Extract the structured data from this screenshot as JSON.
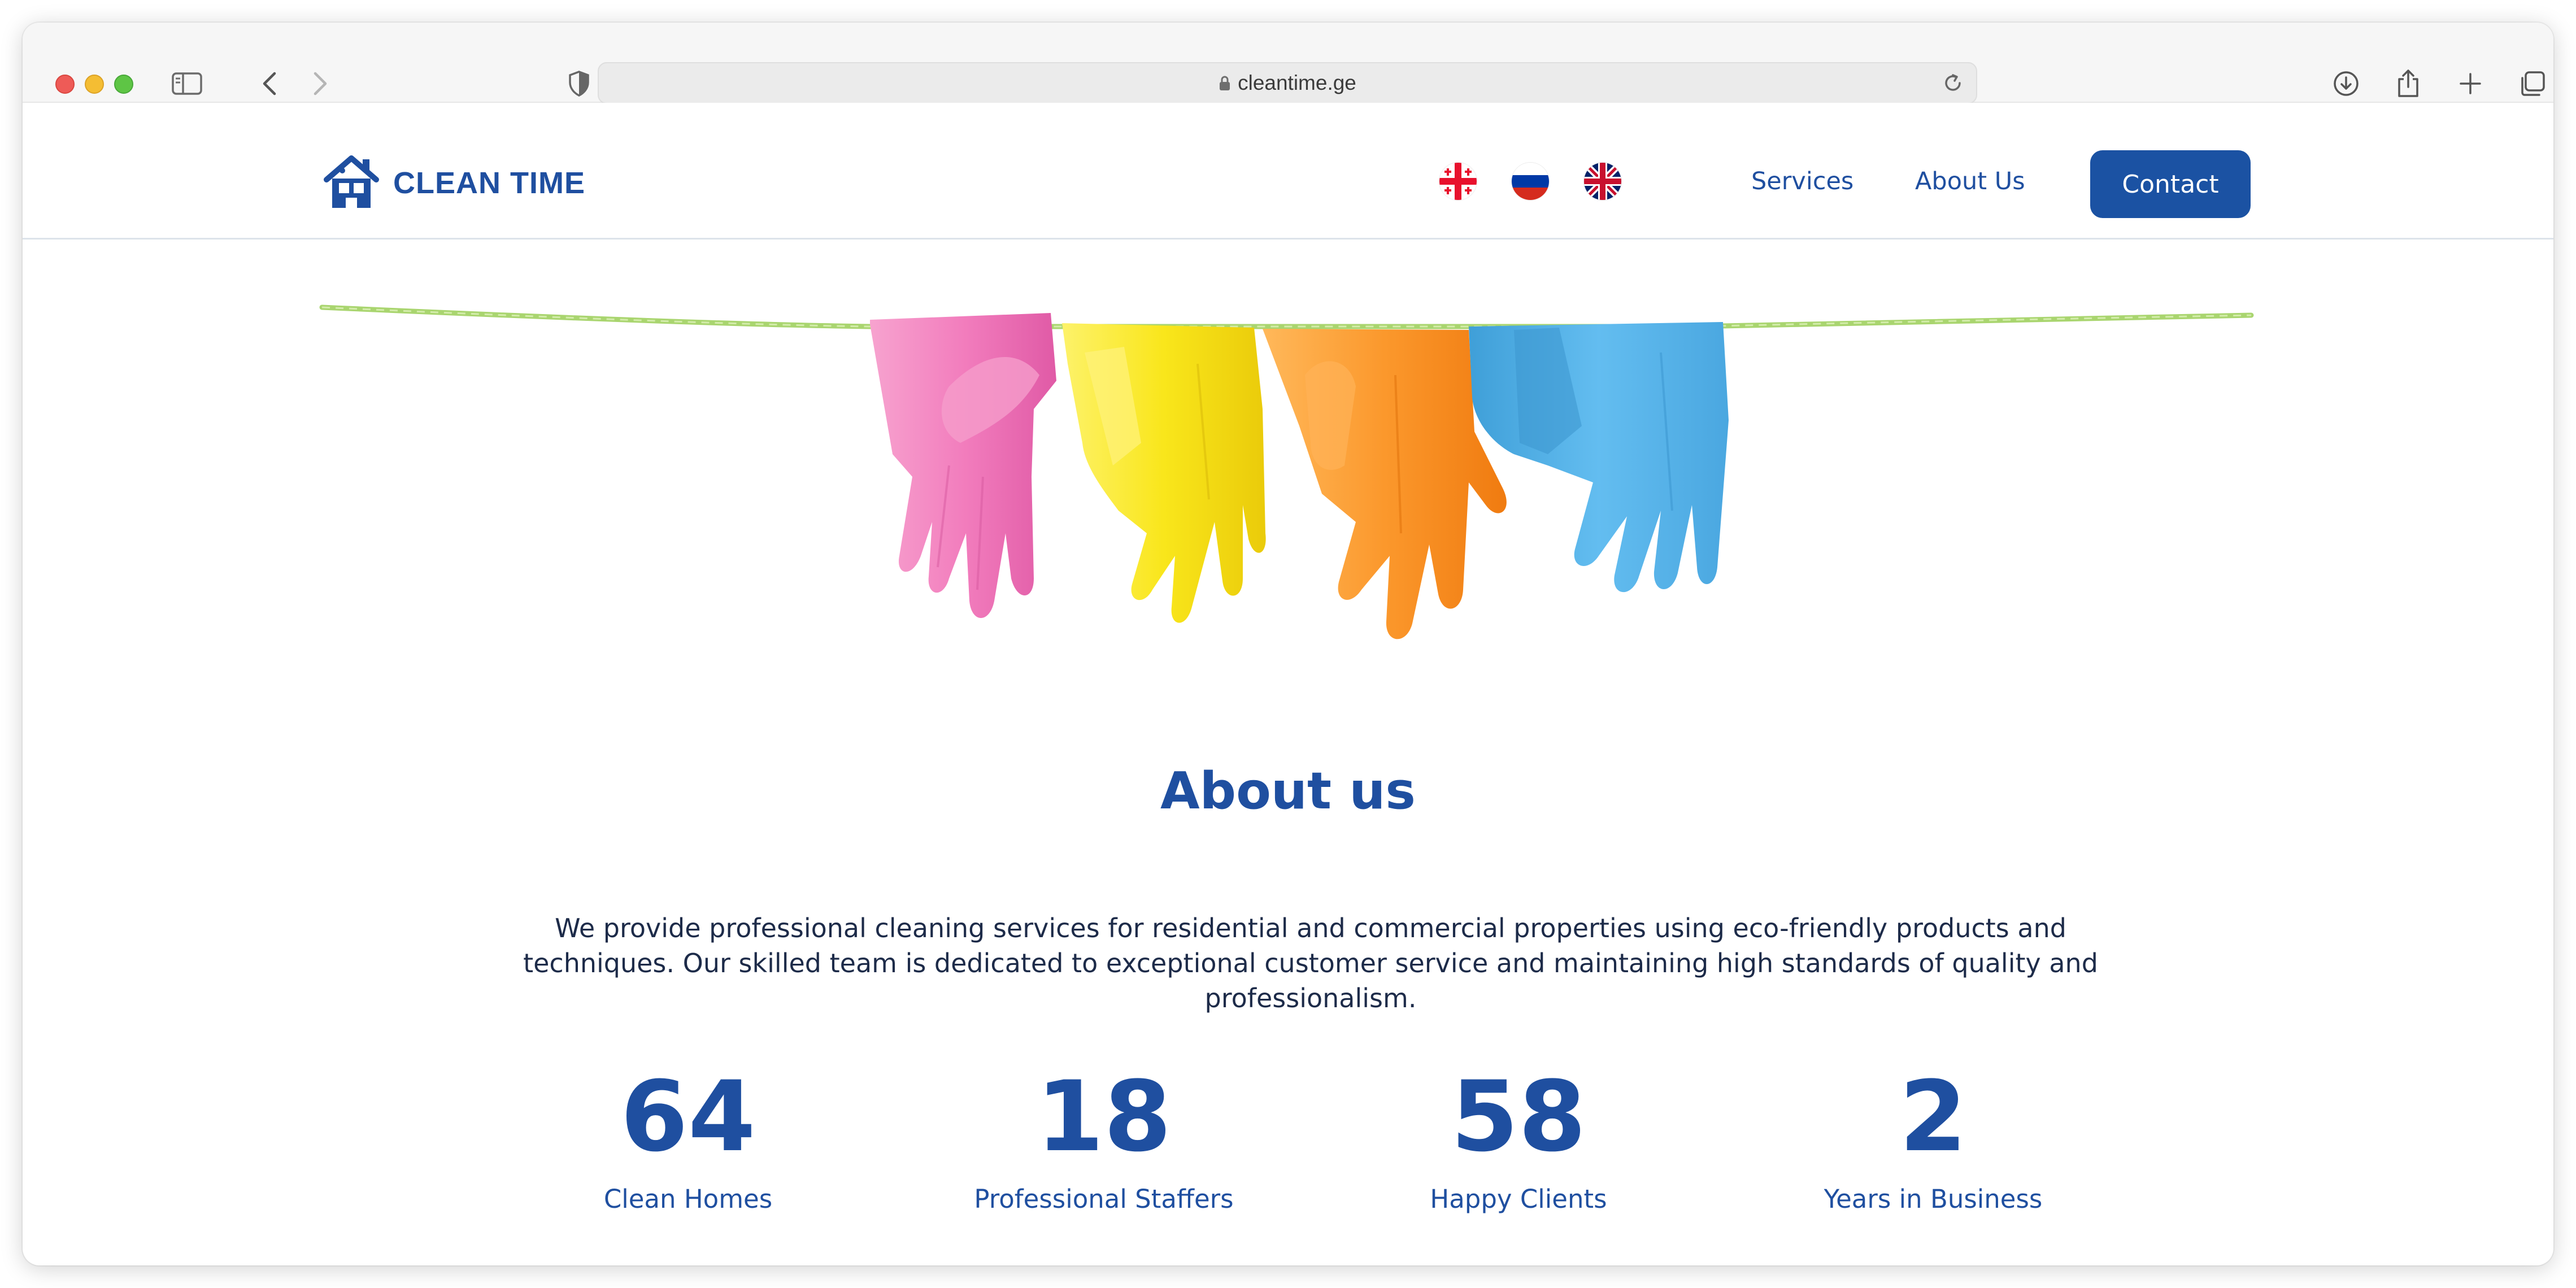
{
  "browser": {
    "url": "cleantime.ge"
  },
  "site": {
    "logo_text": "CLEAN TIME",
    "nav": {
      "services": "Services",
      "about": "About Us",
      "contact": "Contact"
    },
    "languages": [
      "georgian-flag",
      "russian-flag",
      "uk-flag"
    ]
  },
  "about": {
    "title": "About us",
    "text": "We provide professional cleaning services for residential and commercial properties using eco-friendly products and techniques. Our skilled team is dedicated to exceptional customer service and maintaining high standards of quality and professionalism."
  },
  "stats": [
    {
      "value": "64",
      "label": "Clean Homes"
    },
    {
      "value": "18",
      "label": "Professional Staffers"
    },
    {
      "value": "58",
      "label": "Happy Clients"
    },
    {
      "value": "2",
      "label": "Years in Business"
    }
  ],
  "colors": {
    "brand": "#1f4fa0",
    "button": "#1b52a3",
    "glove_pink": "#f07fbe",
    "glove_yellow": "#f9e81a",
    "glove_orange": "#fb9a2e",
    "glove_blue": "#5ab6eb",
    "rope": "#a8d46a"
  }
}
